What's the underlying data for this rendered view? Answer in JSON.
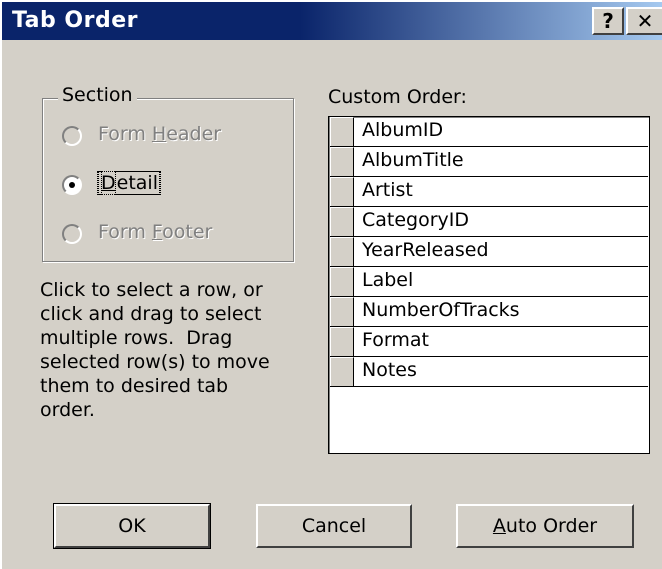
{
  "window": {
    "title": "Tab Order",
    "help_glyph": "?",
    "close_glyph": "✕"
  },
  "section": {
    "legend": "Section",
    "options": [
      {
        "prefix": "Form ",
        "accel": "H",
        "suffix": "eader",
        "enabled": false,
        "selected": false
      },
      {
        "prefix": "",
        "accel": "D",
        "suffix": "etail",
        "enabled": true,
        "selected": true
      },
      {
        "prefix": "Form ",
        "accel": "F",
        "suffix": "ooter",
        "enabled": false,
        "selected": false
      }
    ]
  },
  "help_text": {
    "lines": [
      "Click to select a row, or",
      "click and drag to select",
      "multiple rows.  Drag",
      "selected row(s) to move",
      "them to desired tab",
      "order."
    ]
  },
  "custom_order": {
    "label": "Custom Order:",
    "rows": [
      "AlbumID",
      "AlbumTitle",
      "Artist",
      "CategoryID",
      "YearReleased",
      "Label",
      "NumberOfTracks",
      "Format",
      "Notes"
    ]
  },
  "buttons": {
    "ok": {
      "prefix": "OK",
      "accel": "",
      "suffix": ""
    },
    "cancel": {
      "prefix": "Cancel",
      "accel": "",
      "suffix": ""
    },
    "auto_order": {
      "prefix": "",
      "accel": "A",
      "suffix": "uto Order"
    }
  }
}
